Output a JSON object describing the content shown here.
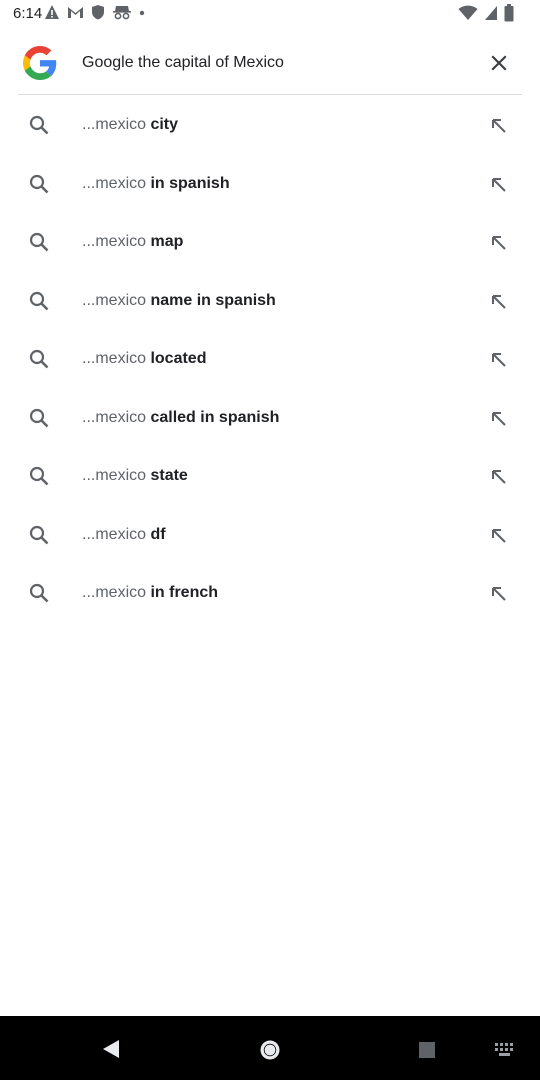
{
  "status_bar": {
    "time": "6:14",
    "left_icons": [
      "alert-icon",
      "gmail-icon",
      "shield-icon",
      "incognito-icon",
      "dot-icon"
    ],
    "right_icons": [
      "wifi-icon",
      "signal-icon",
      "battery-icon"
    ]
  },
  "search": {
    "query": "Google the capital of Mexico",
    "logo": "google-g-logo",
    "clear_icon": "close-icon"
  },
  "suggestions": [
    {
      "prefix": "...mexico",
      "suffix": " city"
    },
    {
      "prefix": "...mexico",
      "suffix": " in spanish"
    },
    {
      "prefix": "...mexico",
      "suffix": " map"
    },
    {
      "prefix": "...mexico",
      "suffix": " name in spanish"
    },
    {
      "prefix": "...mexico",
      "suffix": " located"
    },
    {
      "prefix": "...mexico",
      "suffix": " called in spanish"
    },
    {
      "prefix": "...mexico",
      "suffix": " state"
    },
    {
      "prefix": "...mexico",
      "suffix": " df"
    },
    {
      "prefix": "...mexico",
      "suffix": " in french"
    }
  ],
  "nav_bar": {
    "icons": [
      "back-icon",
      "home-icon",
      "recents-icon",
      "keyboard-icon"
    ]
  },
  "colors": {
    "google_blue": "#4285F4",
    "google_red": "#EA4335",
    "google_yellow": "#FBBC05",
    "google_green": "#34A853",
    "icon_gray": "#5f6368",
    "divider": "#dadce0"
  }
}
